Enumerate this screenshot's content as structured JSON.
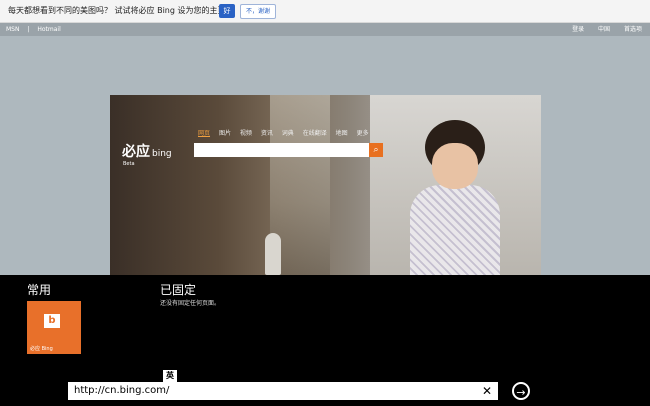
{
  "notification": {
    "message": "每天都想看到不同的美图吗？ 试试将必应 Bing 设为您的主页。",
    "yes_label": "好",
    "no_label": "不，谢谢"
  },
  "top_links": {
    "left": [
      "MSN",
      "|",
      "Hotmail"
    ],
    "right": [
      "登录",
      "中国",
      "首选项"
    ]
  },
  "bing": {
    "logo_cn": "必应",
    "logo_en": "bing",
    "beta": "Beta",
    "tabs": [
      "网页",
      "图片",
      "视频",
      "资讯",
      "词典",
      "在线翻译",
      "地图",
      "更多"
    ],
    "active_tab": "网页"
  },
  "panel": {
    "frequent_heading": "常用",
    "pinned_heading": "已固定",
    "pinned_empty": "还没有固定任何页面。",
    "tile_label": "必应 Bing",
    "tile_color": "#e8702a"
  },
  "address_bar": {
    "value": "http://cn.bing.com/",
    "ime_label": "英"
  },
  "icons": {
    "clear": "close-icon",
    "go": "arrow-right-circle-icon",
    "search": "search-icon"
  }
}
